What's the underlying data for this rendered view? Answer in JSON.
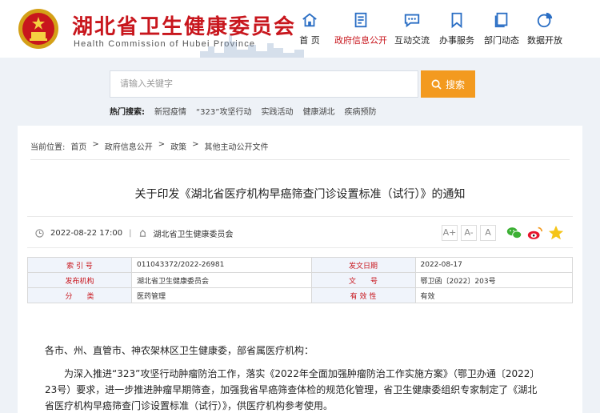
{
  "site": {
    "title": "湖北省卫生健康委员会",
    "subtitle": "Health Commission of Hubei Province",
    "brand_color": "#c8161d",
    "accent_color": "#f39a1f"
  },
  "nav": [
    {
      "label": "首 页",
      "icon": "home-icon"
    },
    {
      "label": "政府信息公开",
      "icon": "document-icon",
      "active": true
    },
    {
      "label": "互动交流",
      "icon": "chat-icon"
    },
    {
      "label": "办事服务",
      "icon": "bookmark-icon"
    },
    {
      "label": "部门动态",
      "icon": "notes-icon"
    },
    {
      "label": "数据开放",
      "icon": "pie-chart-icon"
    }
  ],
  "search": {
    "placeholder": "请输入关键字",
    "button_label": "搜索",
    "hot_label": "热门搜索:",
    "hot_terms": [
      "新冠疫情",
      "“323”攻坚行动",
      "实践活动",
      "健康湖北",
      "疾病预防"
    ]
  },
  "breadcrumb": {
    "prefix": "当前位置:",
    "items": [
      "首页",
      "政府信息公开",
      "政策",
      "其他主动公开文件"
    ],
    "sep": ">"
  },
  "article": {
    "title": "关于印发《湖北省医疗机构早癌筛查门诊设置标准（试行）》的通知",
    "date": "2022-08-22 17:00",
    "source": "湖北省卫生健康委员会",
    "font_sizes": [
      "A+",
      "A-",
      "A"
    ],
    "share_icons": [
      "wechat-icon",
      "weibo-icon",
      "favorite-icon"
    ]
  },
  "info": {
    "rows": [
      [
        "索 引 号",
        "011043372/2022-26981",
        "发文日期",
        "2022-08-17"
      ],
      [
        "发布机构",
        "湖北省卫生健康委员会",
        "文　　号",
        "鄂卫函〔2022〕203号"
      ],
      [
        "分　　类",
        "医药管理",
        "有 效 性",
        "有效"
      ]
    ]
  },
  "body": {
    "greeting": "各市、州、直管市、神农架林区卫生健康委，部省属医疗机构：",
    "paragraph": "为深入推进“323”攻坚行动肿瘤防治工作，落实《2022年全面加强肿瘤防治工作实施方案》（鄂卫办通〔2022〕23号）要求，进一步推进肿瘤早期筛查，加强我省早癌筛查体检的规范化管理，省卫生健康委组织专家制定了《湖北省医疗机构早癌筛查门诊设置标准（试行）》，供医疗机构参考使用。"
  }
}
